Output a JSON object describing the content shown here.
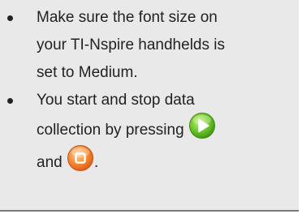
{
  "bullets": [
    {
      "lines": [
        "Make sure the font size on",
        "your TI-Nspire handhelds is",
        "set to Medium."
      ]
    },
    {
      "line1": "You start and stop data",
      "line2": "collection by pressing",
      "line3_prefix": "and",
      "line3_suffix": ".",
      "start_icon": "green-play-button-icon",
      "stop_icon": "orange-stop-button-icon"
    }
  ],
  "colors": {
    "background": "#e9e9e9",
    "text": "#222222",
    "start_green": "#5cbf1f",
    "stop_orange": "#f07a23"
  }
}
